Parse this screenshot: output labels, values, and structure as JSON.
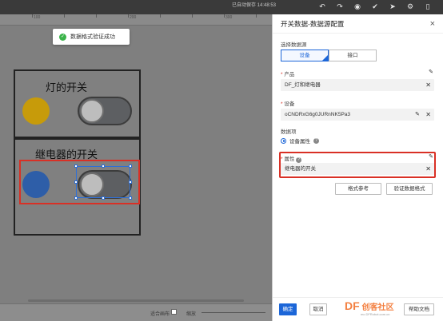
{
  "topbar": {
    "timestamp": "已自动保存 14:48:53",
    "icons": [
      "undo-icon",
      "redo-icon",
      "preview-icon",
      "publish-icon",
      "share-icon",
      "settings-icon",
      "mobile-icon"
    ]
  },
  "ruler": {
    "labels": [
      "100",
      "200",
      "300"
    ]
  },
  "toast": {
    "message": "数据格式验证成功"
  },
  "canvas": {
    "widgets": [
      {
        "title": "灯的开关",
        "lamp_color": "#c79b0a"
      },
      {
        "title": "继电器的开关",
        "lamp_color": "#2e5ea8"
      }
    ],
    "fit_label": "适合画布",
    "zoom_label": "缩放"
  },
  "panel": {
    "title": "开关数据-数据源配置",
    "source_label": "选择数据源",
    "source_options": [
      "设备",
      "接口"
    ],
    "product_label": "产品",
    "product_value": "DF_灯和继电器",
    "device_label": "设备",
    "device_value": "oCNDRxG6g0JURnNK5Pa3",
    "data_item_label": "数据项",
    "device_attr_label": "设备属性",
    "attr_label": "属性",
    "attr_value": "继电器的开关",
    "format_ref_button": "格式参考",
    "validate_button": "验证数据格式",
    "confirm_button": "确定",
    "cancel_button": "取消",
    "help_doc_button": "帮助文档"
  },
  "watermark": {
    "brand": "DF",
    "text": "创客社区",
    "url": "mc.DFRobot.com.cn"
  }
}
